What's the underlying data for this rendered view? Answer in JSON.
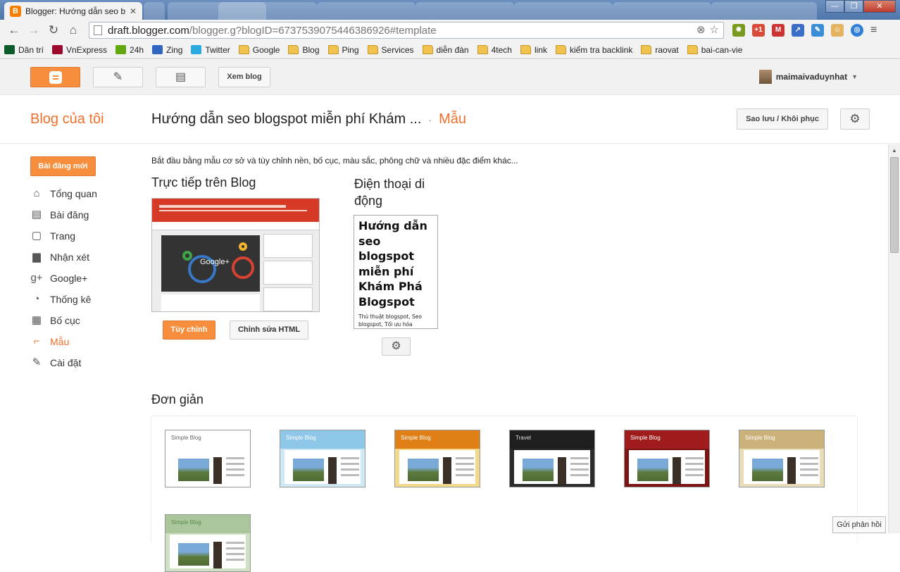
{
  "browser": {
    "active_tab_title": "Blogger: Hướng dẫn seo b",
    "url_host": "draft.blogger.com",
    "url_path": "/blogger.g?blogID=6737539075446386926#template",
    "bookmarks": [
      {
        "label": "Dân trí",
        "icon": "dantri-icon",
        "color": "#0b5c2a"
      },
      {
        "label": "VnExpress",
        "icon": "vnexpress-icon",
        "color": "#9d0a2b"
      },
      {
        "label": "24h",
        "icon": "24h-icon",
        "color": "#62a70f"
      },
      {
        "label": "Zing",
        "icon": "zing-icon",
        "color": "#2f66c2"
      },
      {
        "label": "Twitter",
        "icon": "twitter-icon",
        "color": "#2aa9e0"
      },
      {
        "label": "Google",
        "icon": "folder-icon"
      },
      {
        "label": "Blog",
        "icon": "folder-icon"
      },
      {
        "label": "Ping",
        "icon": "folder-icon"
      },
      {
        "label": "Services",
        "icon": "folder-icon"
      },
      {
        "label": "diễn đàn",
        "icon": "folder-icon"
      },
      {
        "label": "4tech",
        "icon": "folder-icon"
      },
      {
        "label": "link",
        "icon": "folder-icon"
      },
      {
        "label": "kiểm tra backlink",
        "icon": "folder-icon"
      },
      {
        "label": "raovat",
        "icon": "folder-icon"
      },
      {
        "label": "bai-can-vie",
        "icon": "folder-icon"
      }
    ]
  },
  "topbar": {
    "view_blog": "Xem blog",
    "username": "maimaivaduynhat"
  },
  "header": {
    "my_blog": "Blog của tôi",
    "blog_title": "Hướng dẫn seo blogspot miễn phí Khám ...",
    "separator": "·",
    "section": "Mẫu",
    "backup_button": "Sao lưu / Khôi phục"
  },
  "sidebar": {
    "new_post": "Bài đăng mới",
    "items": [
      {
        "label": "Tổng quan",
        "icon": "home-icon",
        "glyph": "⌂"
      },
      {
        "label": "Bài đăng",
        "icon": "posts-icon",
        "glyph": "▤"
      },
      {
        "label": "Trang",
        "icon": "page-icon",
        "glyph": "▢"
      },
      {
        "label": "Nhận xét",
        "icon": "comment-icon",
        "glyph": "▆"
      },
      {
        "label": "Google+",
        "icon": "google-plus-icon",
        "glyph": "g+"
      },
      {
        "label": "Thống kê",
        "icon": "stats-pie-icon",
        "glyph": "◔"
      },
      {
        "label": "Bố cục",
        "icon": "layout-icon",
        "glyph": "▦"
      },
      {
        "label": "Mẫu",
        "icon": "template-brush-icon",
        "glyph": "⌐",
        "selected": true
      },
      {
        "label": "Cài đặt",
        "icon": "wrench-icon",
        "glyph": "✎"
      }
    ]
  },
  "main": {
    "intro": "Bắt đầu bằng mẫu cơ sở và tùy chỉnh nền, bố cục, màu sắc, phông chữ và nhiều đặc điểm khác...",
    "live_heading": "Trực tiếp trên Blog",
    "mobile_heading": "Điện thoại di động",
    "customize_button": "Tùy chỉnh",
    "edit_html_button": "Chỉnh sửa HTML",
    "live_preview": {
      "hero_text": "Google+"
    },
    "mobile_preview": {
      "title": "Hướng dẫn seo blogspot miễn phí Khám Phá Blogspot",
      "description": "Thủ thuật blogspot, Seo blogspot, Tối ưu hóa blogspot, Giao diện blogspot, Theme blogspot, Thiết kế"
    },
    "simple_heading": "Đơn giản",
    "templates": [
      {
        "label": "Simple Blog",
        "head": "#ffffff",
        "bg": "#ffffff",
        "text": "#666666"
      },
      {
        "label": "Simple Blog",
        "head": "#8fc7e8",
        "bg": "#cfe8f5",
        "text": "#ffffff"
      },
      {
        "label": "Simple Blog",
        "head": "#e07f16",
        "bg": "#f3d98c",
        "text": "#ffffff"
      },
      {
        "label": "Travel",
        "head": "#1e1e1e",
        "bg": "#2b2b2b",
        "text": "#dddddd"
      },
      {
        "label": "Simple Blog",
        "head": "#a01c1c",
        "bg": "#7d1414",
        "text": "#ffffff"
      },
      {
        "label": "Simple Blog",
        "head": "#cbb27a",
        "bg": "#e9dcb8",
        "text": "#ffffff"
      },
      {
        "label": "Simple Blog",
        "head": "#a9c79b",
        "bg": "#cfe0c3",
        "text": "#5c8a4a"
      }
    ]
  },
  "feedback": "Gửi phản hồi",
  "colors": {
    "accent": "#f68e3d",
    "accent_text": "#f06f29"
  }
}
